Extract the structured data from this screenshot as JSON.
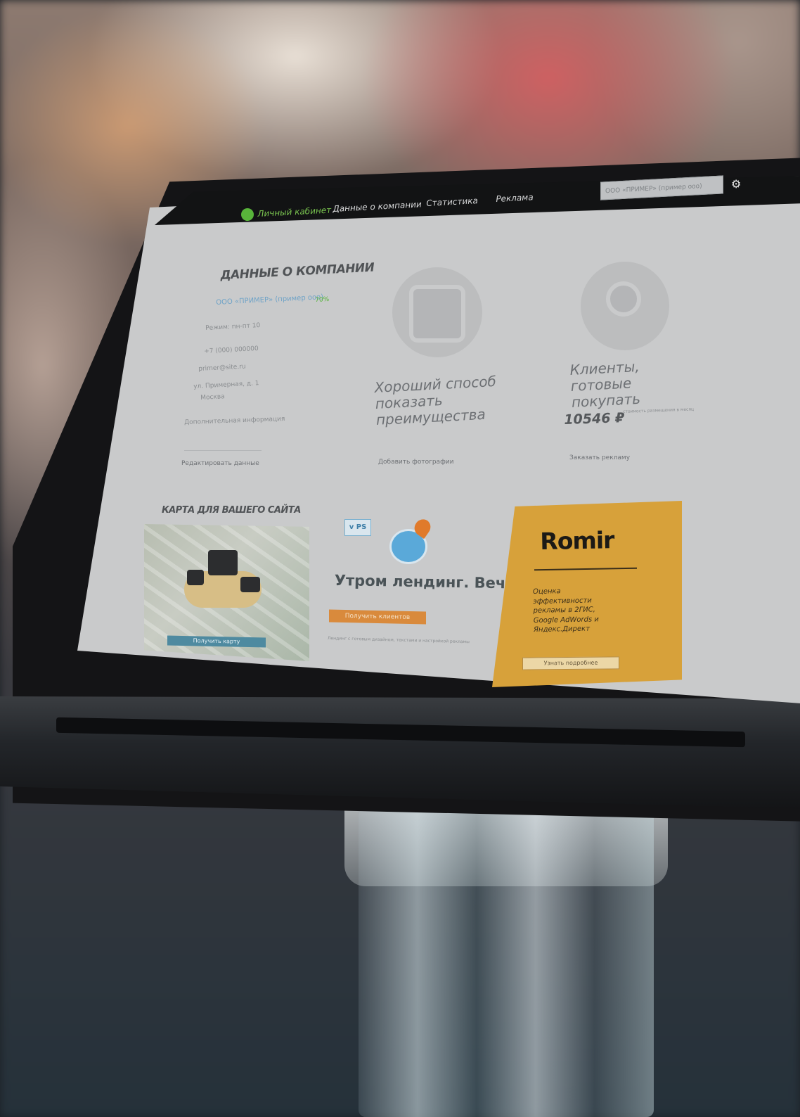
{
  "nav": {
    "logo": "Личный кабинет",
    "items": [
      "Данные о компании",
      "Статистика",
      "Реклама"
    ],
    "search_value": "ООО «ПРИМЕР» (пример ооо)"
  },
  "company": {
    "heading": "ДАННЫЕ О КОМПАНИИ",
    "link": "ООО «ПРИМЕР» (пример ооо)",
    "percent": "70%",
    "line1": "Режим: пн-пт 10",
    "line2": "+7 (000) 000000",
    "line3": "primer@site.ru",
    "line4": "ул. Примерная, д. 1",
    "line5": "Москва",
    "note": "Дополнительная информация",
    "action": "Редактировать данные"
  },
  "card_photos": {
    "title": "Хороший способ показать преимущества",
    "action": "Добавить фотографии"
  },
  "card_clients": {
    "title": "Клиенты, готовые покупать",
    "price": "10546 ₽",
    "price_note": "стоимость размещения в месяц",
    "action": "Заказать рекламу"
  },
  "map_block": {
    "heading": "КАРТА ДЛЯ ВАШЕГО САЙТА",
    "button": "Получить карту"
  },
  "promo": {
    "badge": "v PS",
    "title": "Утром лендинг. Вечером клиенты",
    "button": "Получить клиентов",
    "note": "Лендинг с готовым дизайном, текстами и настройкой рекламы"
  },
  "romir": {
    "logo": "Romir",
    "text": "Оценка эффективности рекламы в 2ГИС, Google AdWords и Яндекс.Директ",
    "button": "Узнать подробнее"
  },
  "colors": {
    "accent_green": "#58b53a",
    "promo_orange": "#d98a3c",
    "romir_yellow": "#d7a13a",
    "screen_grey": "#c9cacb"
  }
}
